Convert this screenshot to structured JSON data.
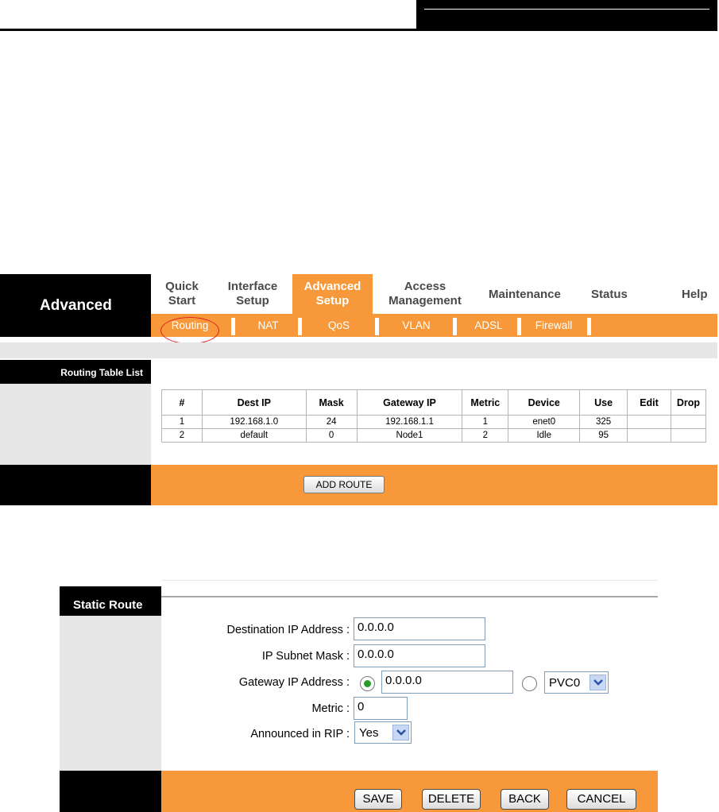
{
  "panel": {
    "brand_title": "Advanced",
    "nav": {
      "quick_start": {
        "line1": "Quick",
        "line2": "Start"
      },
      "interface_setup": {
        "line1": "Interface",
        "line2": "Setup"
      },
      "advanced_setup": {
        "line1": "Advanced",
        "line2": "Setup"
      },
      "access_management": {
        "line1": "Access",
        "line2": "Management"
      },
      "maintenance": "Maintenance",
      "status": "Status",
      "help": "Help"
    },
    "subnav": {
      "routing": "Routing",
      "nat": "NAT",
      "qos": "QoS",
      "vlan": "VLAN",
      "adsl": "ADSL",
      "firewall": "Firewall"
    },
    "section_label": "Routing Table List",
    "table": {
      "headers": [
        "#",
        "Dest IP",
        "Mask",
        "Gateway IP",
        "Metric",
        "Device",
        "Use",
        "Edit",
        "Drop"
      ],
      "rows": [
        [
          "1",
          "192.168.1.0",
          "24",
          "192.168.1.1",
          "1",
          "enet0",
          "325",
          "",
          ""
        ],
        [
          "2",
          "default",
          "0",
          "Node1",
          "2",
          "Idle",
          "95",
          "",
          ""
        ]
      ]
    },
    "add_route_label": "ADD ROUTE"
  },
  "static_route": {
    "title": "Static Route",
    "dest_ip": {
      "label": "Destination IP Address :",
      "value": "0.0.0.0"
    },
    "subnet_mask": {
      "label": "IP Subnet Mask :",
      "value": "0.0.0.0"
    },
    "gateway_ip": {
      "label": "Gateway IP Address :",
      "value": "0.0.0.0",
      "pvc_value": "PVC0"
    },
    "metric": {
      "label": "Metric :",
      "value": "0"
    },
    "rip": {
      "label": "Announced in RIP :",
      "value": "Yes"
    },
    "buttons": {
      "save": "SAVE",
      "delete": "DELETE",
      "back": "BACK",
      "cancel": "CANCEL"
    }
  }
}
